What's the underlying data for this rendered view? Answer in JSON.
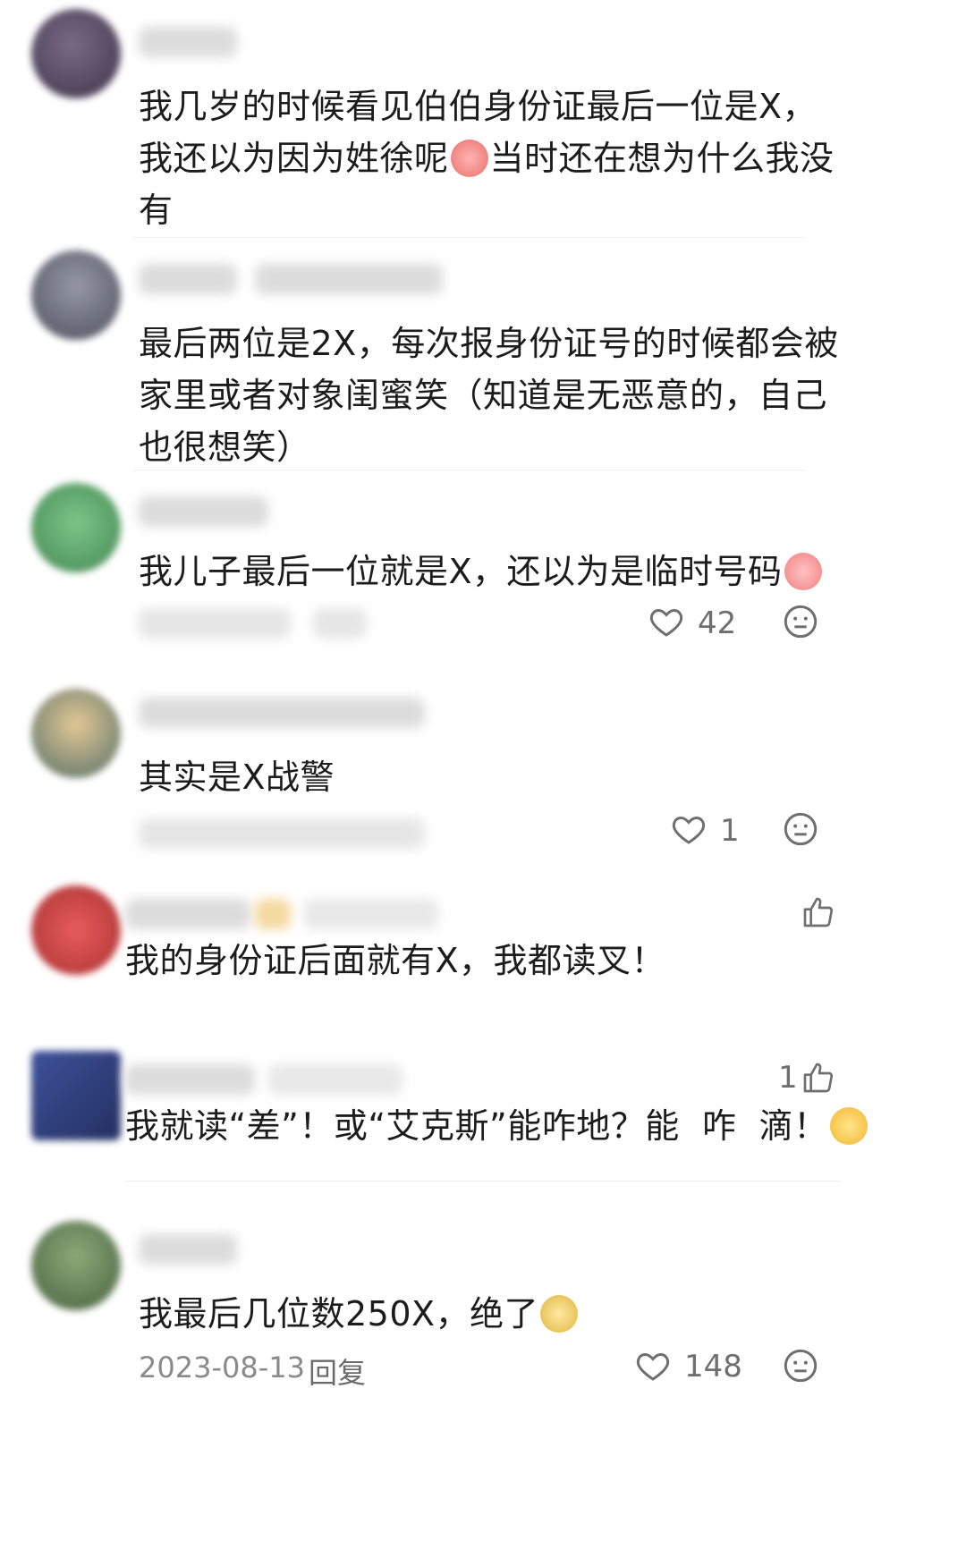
{
  "comments": [
    {
      "text": "我几岁的时候看见伯伯身份证最后一位是X，\n我还以为因为姓徐呢",
      "text_after": "当时还在想为什么我没\n有",
      "emoji": "crying-face-icon"
    },
    {
      "text": "最后两位是2X，每次报身份证号的时候都会被\n家里或者对象闺蜜笑（知道是无恶意的，自己\n也很想笑）"
    },
    {
      "text": "我儿子最后一位就是X，还以为是临时号码",
      "emoji": "crying-face-icon",
      "likes": "42"
    },
    {
      "text": "其实是X战警",
      "likes": "1"
    },
    {
      "text": "我的身份证后面就有X，我都读叉！"
    },
    {
      "text": "我就读“差”！或“艾克斯”能咋地？能  咋  滴！",
      "emoji": "smirk-face-icon",
      "likes": "1"
    },
    {
      "text": "我最后几位数250X，绝了",
      "emoji": "dog-face-icon",
      "date": "2023-08-13",
      "reply": "回复",
      "likes": "148"
    }
  ],
  "colors": {
    "text": "#1c1c1c",
    "meta": "#8a8a8a",
    "icon": "#6f6f6f"
  }
}
